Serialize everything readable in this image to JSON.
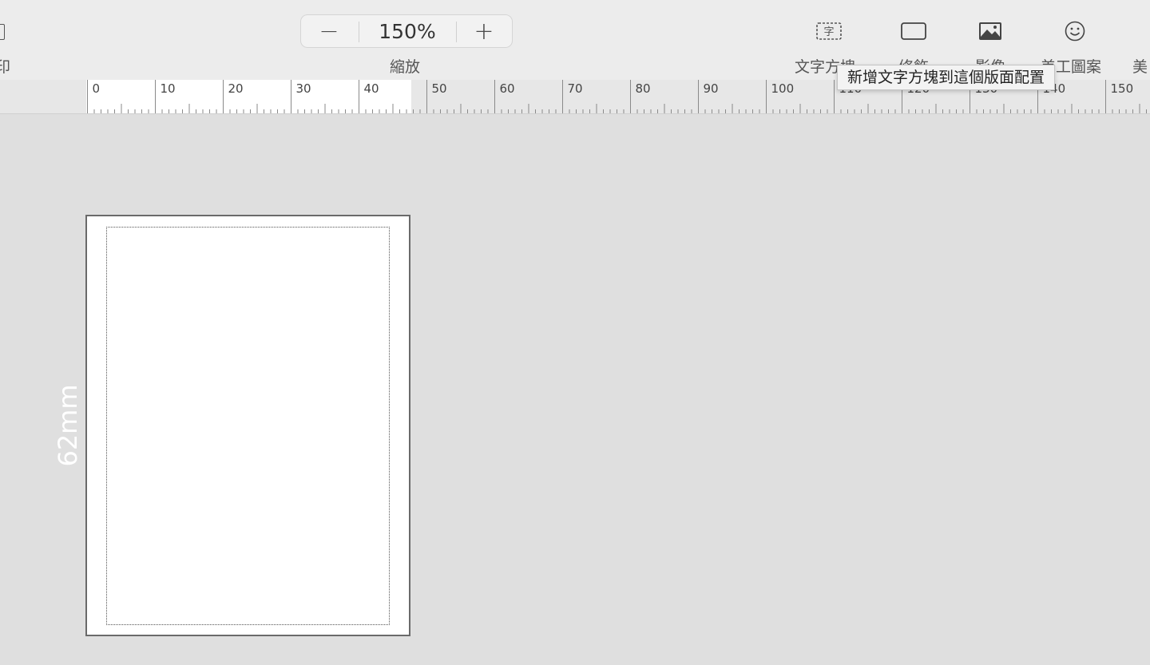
{
  "toolbar": {
    "left_partial_label": "印",
    "zoom": {
      "minus": "−",
      "value": "150%",
      "plus": "+",
      "label": "縮放"
    },
    "items": [
      {
        "label": "文字方塊",
        "icon": "text-box-icon"
      },
      {
        "label": "修飾",
        "icon": "shape-icon"
      },
      {
        "label": "影像",
        "icon": "image-icon"
      },
      {
        "label": "美工圖案",
        "icon": "smiley-icon"
      },
      {
        "label": "美",
        "icon": ""
      }
    ],
    "tooltip": "新增文字方塊到這個版面配置"
  },
  "ruler": {
    "labels": [
      "0",
      "10",
      "20",
      "30",
      "40",
      "50",
      "60",
      "70",
      "80",
      "90",
      "100",
      "110",
      "120",
      "130",
      "140",
      "150"
    ]
  },
  "canvas": {
    "side_dimension": "62mm"
  },
  "colors": {
    "toolbar_bg": "#ececec",
    "canvas_bg": "#dfdfdf",
    "page_bg": "#ffffff"
  }
}
